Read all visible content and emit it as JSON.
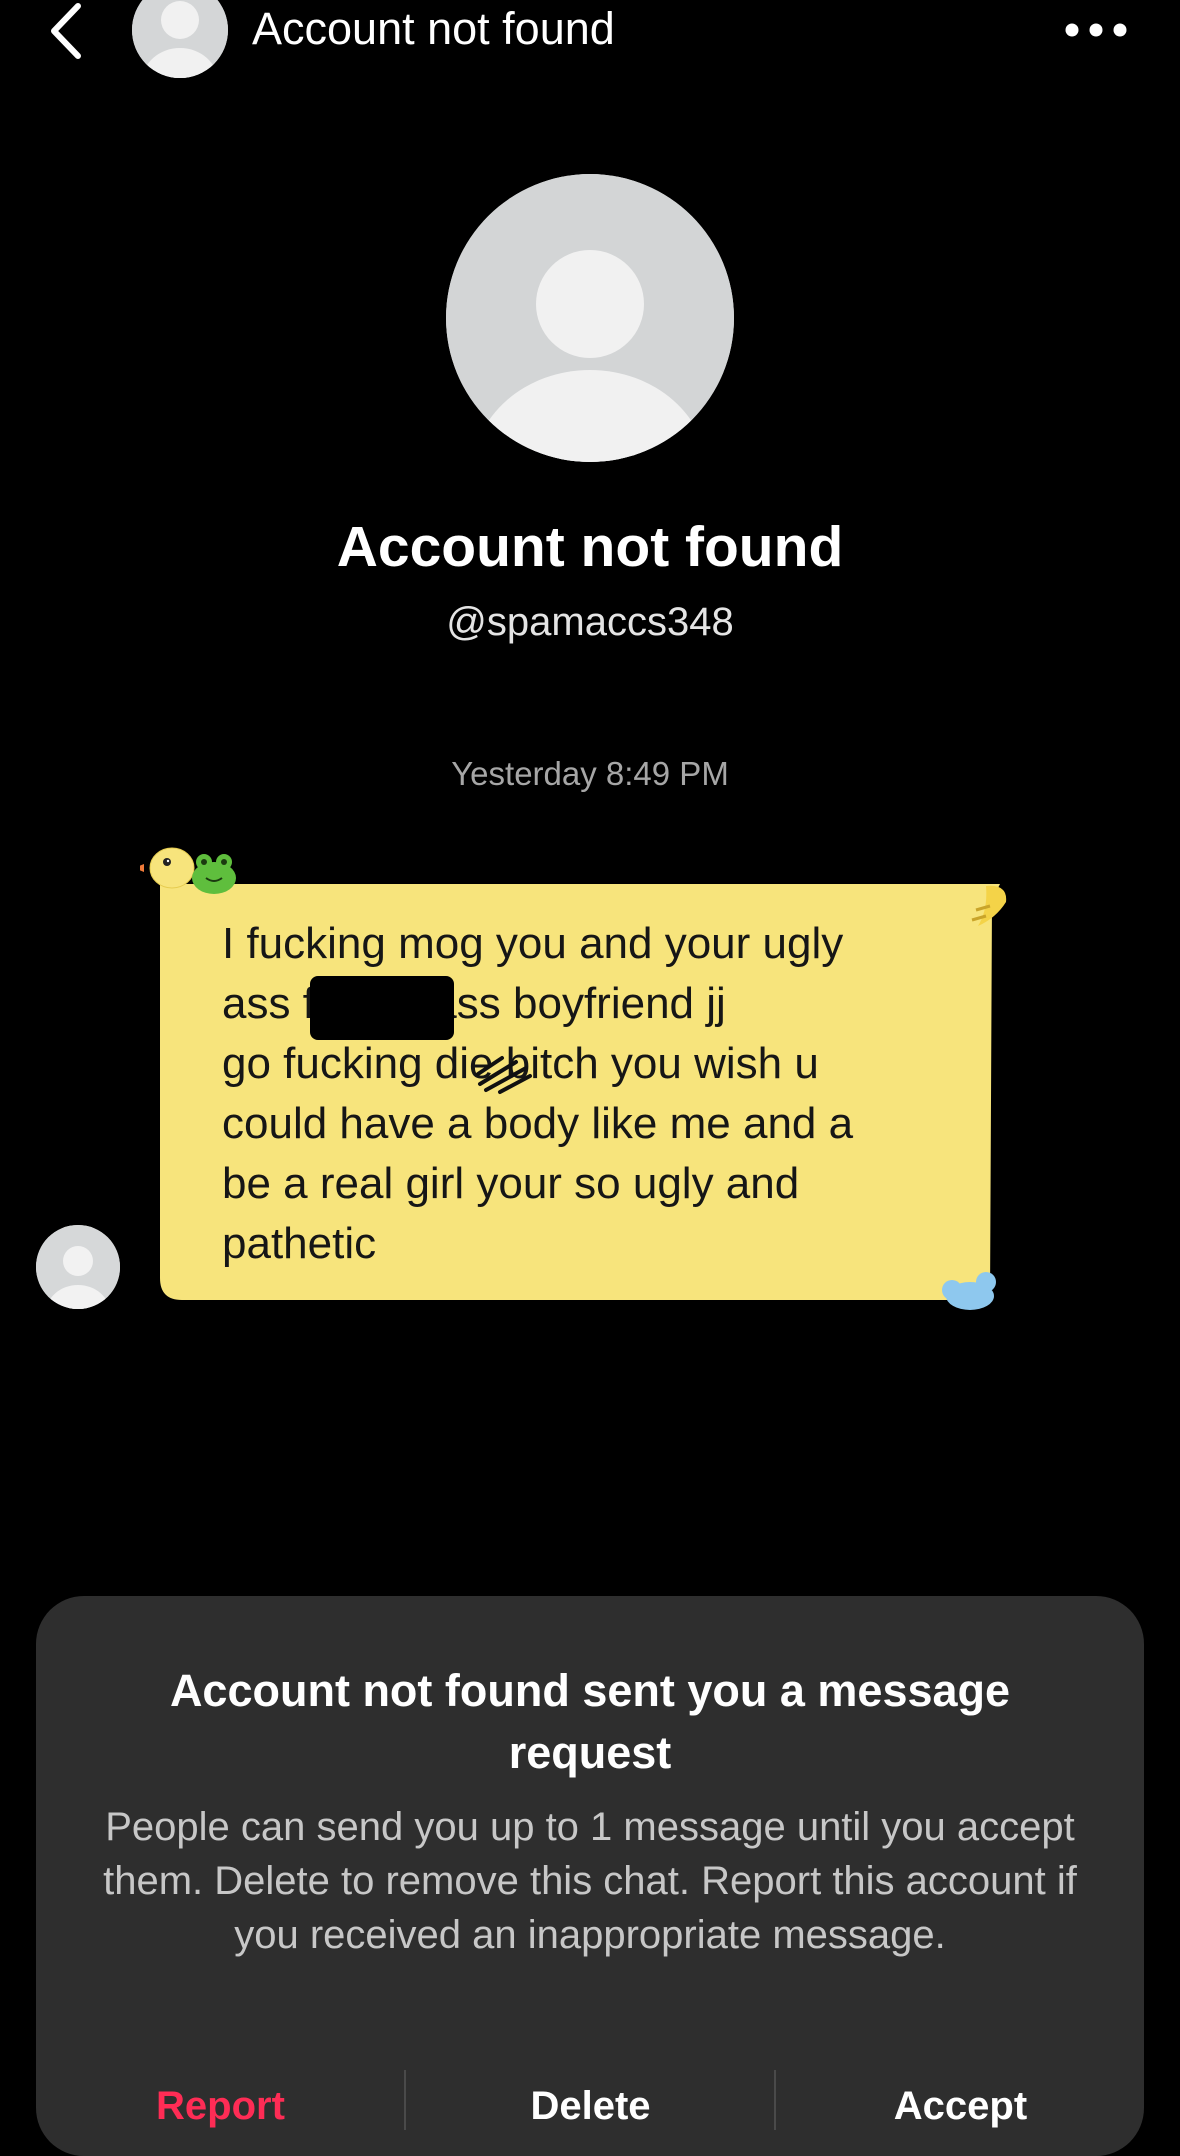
{
  "header": {
    "title": "Account not found",
    "back_icon": "chevron-left-icon",
    "more_icon": "more-horizontal-icon"
  },
  "profile": {
    "name": "Account not found",
    "username": "@spamaccs348"
  },
  "conversation": {
    "timestamp": "Yesterday 8:49 PM",
    "message": {
      "text": "I fucking mog you and your ugly\nass f         bitch ass boyfriend jj\ngo fucking die bitch you wish u\ncould have a body like me and a\nbe a real girl your so ugly and\npathetic",
      "bubble_color": "#f7e47c",
      "decorations": [
        "duck-sticker-icon",
        "frog-sticker-icon",
        "cloud-sticker-icon"
      ]
    }
  },
  "request_sheet": {
    "title": "Account not found sent you a message request",
    "body": "People can send you up to 1 message until you accept them. Delete to remove this chat. Report this account if you received an inappropriate message.",
    "actions": {
      "report": "Report",
      "delete": "Delete",
      "accept": "Accept"
    },
    "report_color": "#fe2c55"
  }
}
